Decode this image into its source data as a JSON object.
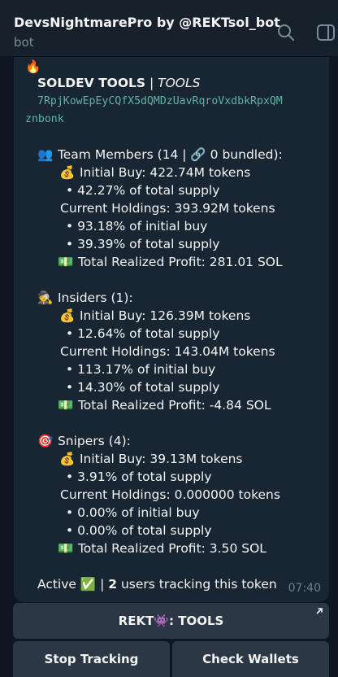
{
  "header": {
    "title": "DevsNightmarePro by @REKTsol_bot",
    "subtitle": "bot"
  },
  "message": {
    "fire_emoji": "🔥",
    "token_title": "SOLDEV TOOLS",
    "separator": " | ",
    "token_ticker": "TOOLS",
    "address_line1": "7RpjKowEpEyCQfX5dQMDzUavRqroVxdbkRpxQM",
    "address_line2": "znbonk",
    "team": {
      "emoji": "👥",
      "heading": "Team Members (14 | 🔗 0 bundled):",
      "buy_emoji": "💰",
      "initial_buy": "Initial Buy: 422.74M tokens",
      "initial_pct": "• 42.27% of total supply",
      "holdings": "Current Holdings: 393.92M tokens",
      "holdings_pct_initial": "• 93.18% of initial buy",
      "holdings_pct_total": "• 39.39% of total supply",
      "profit_emoji": "💵",
      "profit": "Total Realized Profit: 281.01 SOL"
    },
    "insiders": {
      "emoji": "🕵",
      "heading": "Insiders (1):",
      "buy_emoji": "💰",
      "initial_buy": "Initial Buy: 126.39M tokens",
      "initial_pct": "• 12.64% of total supply",
      "holdings": "Current Holdings: 143.04M tokens",
      "holdings_pct_initial": "• 113.17% of initial buy",
      "holdings_pct_total": "• 14.30% of total supply",
      "profit_emoji": "💵",
      "profit": "Total Realized Profit: -4.84 SOL"
    },
    "snipers": {
      "emoji": "🎯",
      "heading": "Snipers (4):",
      "buy_emoji": "💰",
      "initial_buy": "Initial Buy: 39.13M tokens",
      "initial_pct": "• 3.91% of total supply",
      "holdings": "Current Holdings: 0.000000 tokens",
      "holdings_pct_initial": "• 0.00% of initial buy",
      "holdings_pct_total": "• 0.00% of total supply",
      "profit_emoji": "💵",
      "profit": "Total Realized Profit: 3.50 SOL"
    },
    "status_active": "Active ✅",
    "status_separator": " | ",
    "status_count": "2",
    "status_rest": " users tracking this token",
    "time": "07:40"
  },
  "keyboard": {
    "main_button": "REKT👾: TOOLS",
    "stop_tracking": "Stop Tracking",
    "check_wallets": "Check Wallets"
  },
  "colors": {
    "background": "#0e1621",
    "header": "#17212b",
    "bubble": "#182533",
    "button": "#2b3744",
    "address": "#5db5a0"
  },
  "icons": [
    "search-icon",
    "sidebar-toggle-icon",
    "external-link-icon"
  ]
}
